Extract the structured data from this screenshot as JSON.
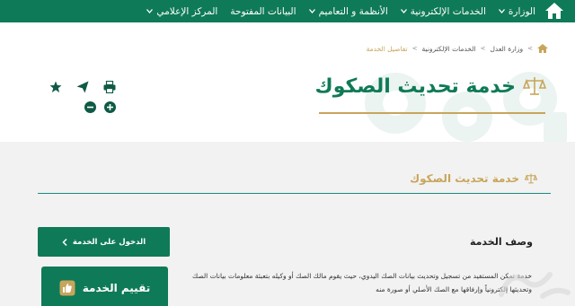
{
  "nav": {
    "items": [
      {
        "label": "الوزارة",
        "has_dropdown": true
      },
      {
        "label": "الخدمات الإلكترونية",
        "has_dropdown": true
      },
      {
        "label": "الأنظمة و التعاميم",
        "has_dropdown": true
      },
      {
        "label": "البيانات المفتوحة",
        "has_dropdown": false
      },
      {
        "label": "المركز الإعلامي",
        "has_dropdown": true
      }
    ],
    "home_icon": "home-icon"
  },
  "breadcrumb": {
    "items": [
      "وزارة العدل",
      "الخدمات الإلكترونية"
    ],
    "current": "تفاصيل الخدمة",
    "separator": ">"
  },
  "header": {
    "title": "خدمة تحديث الصكوك",
    "title_icon": "scales-icon"
  },
  "tools": {
    "icons": [
      "print-icon",
      "send-icon",
      "star-icon",
      "zoom-in-icon",
      "zoom-out-icon"
    ]
  },
  "section": {
    "title": "خدمة تحديث الصكوك"
  },
  "actions": {
    "enter_label": "الدخول على الخدمة",
    "rate_label": "تقييم الخدمة"
  },
  "description": {
    "heading": "وصف الخدمة",
    "text": "خدمة تمكن المستفيد من تسجيل وتحديث بيانات الصك اليدوي، حيث يقوم مالك الصك أو وكيله بتعبئة معلومات بيانات الصك وتحديثها إلكترونياً وإرفاقها مع الصك الأصلي أو صورة منه"
  },
  "colors": {
    "primary": "#0f7a57",
    "accent": "#c8a55a",
    "divider": "#1a8a80"
  }
}
